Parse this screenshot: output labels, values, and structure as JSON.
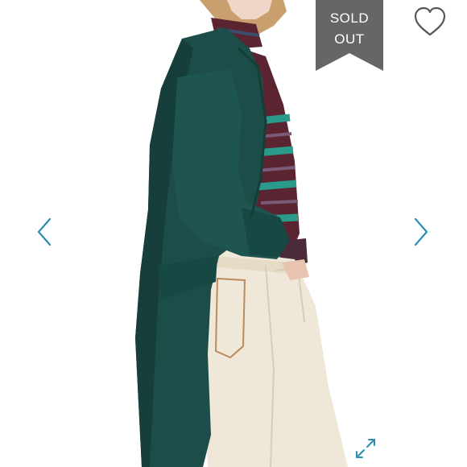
{
  "listing": {
    "status_line1": "SOLD",
    "status_line2": "OUT"
  },
  "colors": {
    "accent": "#2a8fb0",
    "banner": "#666666",
    "cardigan": "#1c4d48",
    "pants": "#efe8d8"
  },
  "icons": {
    "like": "heart-icon",
    "previous": "chevron-left-icon",
    "next": "chevron-right-icon",
    "fullscreen": "expand-icon"
  }
}
